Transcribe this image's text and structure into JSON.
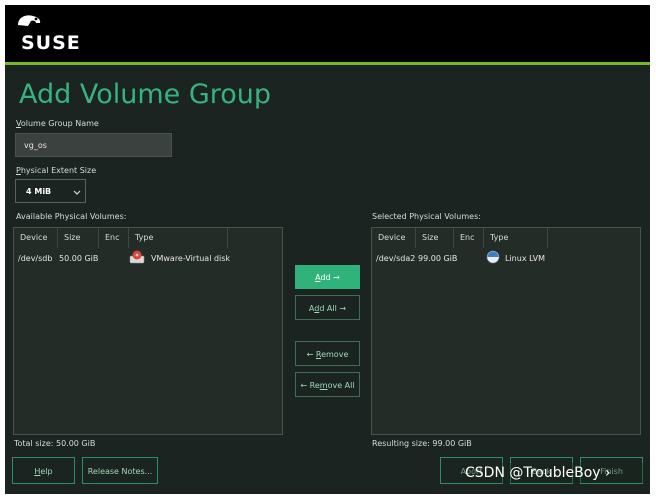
{
  "header": {
    "brand": "SUSE"
  },
  "page": {
    "title": "Add Volume Group"
  },
  "vg_name": {
    "label_underline": "V",
    "label_rest": "olume Group Name",
    "value": "vg_os"
  },
  "extent": {
    "label_underline": "P",
    "label_rest": "hysical Extent Size",
    "value": "4 MiB"
  },
  "available": {
    "label": "Available Physical Volumes:",
    "columns": [
      "Device",
      "Size",
      "Enc",
      "Type"
    ],
    "rows": [
      {
        "device": "/dev/sdb",
        "size": "50.00 GiB",
        "enc": "",
        "type": "VMware-Virtual disk",
        "icon": "disk-icon"
      }
    ],
    "total": "Total size: 50.00 GiB"
  },
  "selected": {
    "label": "Selected Physical Volumes:",
    "columns": [
      "Device",
      "Size",
      "Enc",
      "Type"
    ],
    "rows": [
      {
        "device": "/dev/sda2",
        "size": "99.00 GiB",
        "enc": "",
        "type": "Linux LVM",
        "icon": "lvm-icon"
      }
    ],
    "total": "Resulting size: 99.00 GiB"
  },
  "actions": {
    "add_u": "A",
    "add_rest": "dd →",
    "add_all_pre": "A",
    "add_all_u": "d",
    "add_all_rest": "d All →",
    "remove_pre": "← ",
    "remove_u": "R",
    "remove_rest": "emove",
    "remove_all_pre": "← Re",
    "remove_all_u": "m",
    "remove_all_rest": "ove All"
  },
  "footer": {
    "help_u": "H",
    "help_rest": "elp",
    "release_notes": "Release Notes...",
    "abort": "Abort",
    "back": "Back",
    "finish": "Finish"
  },
  "watermark": "CSDN @TroubleBoy",
  "colors": {
    "accent": "#36b37e",
    "suse_green": "#73ba25",
    "background": "#1b2420"
  }
}
